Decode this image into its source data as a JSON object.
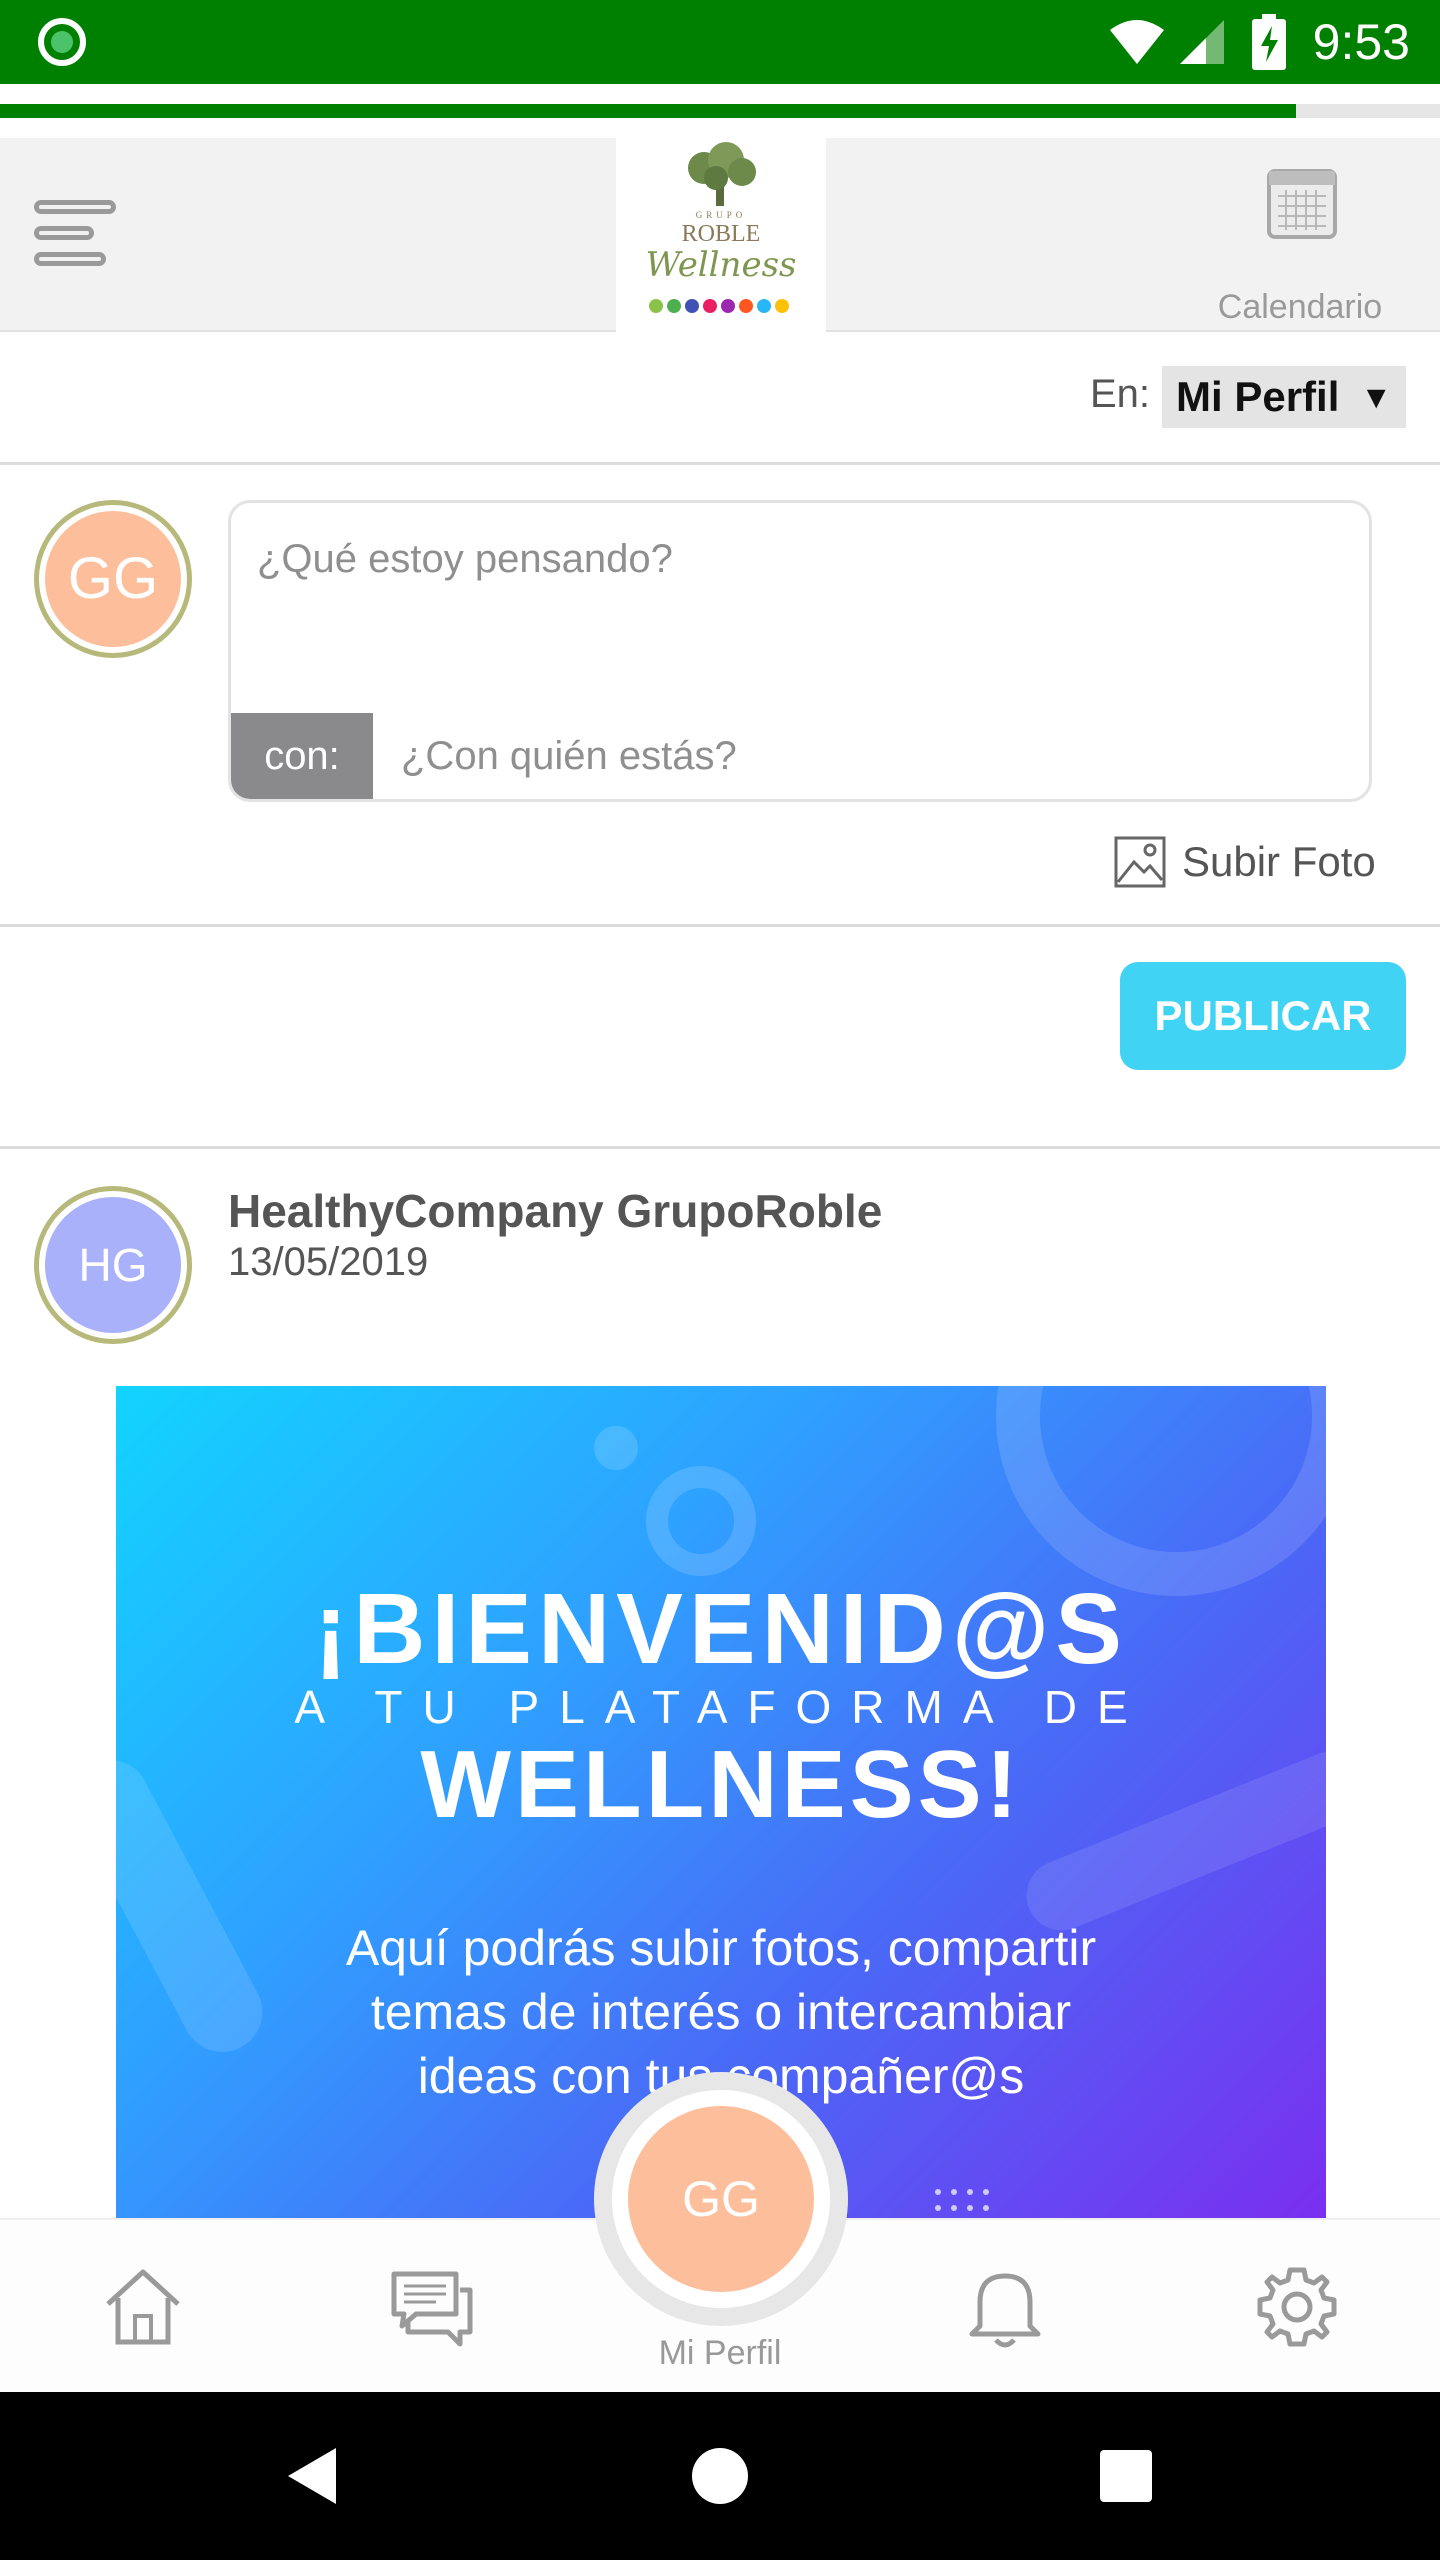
{
  "status_bar": {
    "time": "9:53"
  },
  "progress": {
    "fraction": 0.9
  },
  "header": {
    "logo_text_top": "GRUPO",
    "logo_text_mid": "ROBLE",
    "logo_text_script": "Wellness",
    "calendar_label": "Calendario"
  },
  "scope": {
    "prefix": "En:",
    "selected": "Mi Perfil",
    "caret": "▼"
  },
  "composer": {
    "avatar_initials": "GG",
    "thought_placeholder": "¿Qué estoy pensando?",
    "with_label": "con:",
    "with_placeholder": "¿Con quién estás?",
    "upload_label": "Subir Foto",
    "publish_label": "PUBLICAR"
  },
  "post": {
    "avatar_initials": "HG",
    "author": "HealthyCompany GrupoRoble",
    "date": "13/05/2019",
    "image": {
      "line1": "¡BIENVENID@S",
      "line2": "A TU PLATAFORMA DE",
      "line3": "WELLNESS!",
      "body1": "Aquí podrás subir fotos, compartir",
      "body2": "temas de interés o intercambiar",
      "body3": "ideas con tus compañer@s"
    }
  },
  "bottom_nav": {
    "profile_initials": "GG",
    "profile_label": "Mi Perfil"
  },
  "colors": {
    "status_green": "#008000",
    "publish_blue": "#40d3f4",
    "avatar_peach": "#fdbf9b",
    "avatar_lavender": "#aab1fb",
    "avatar_ring": "#b6b97a"
  }
}
